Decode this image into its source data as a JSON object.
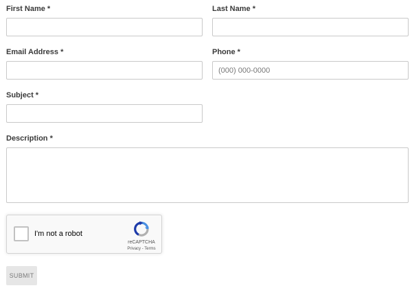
{
  "form": {
    "first_name": {
      "label": "First Name *",
      "value": "",
      "placeholder": ""
    },
    "last_name": {
      "label": "Last Name *",
      "value": "",
      "placeholder": ""
    },
    "email": {
      "label": "Email Address *",
      "value": "",
      "placeholder": ""
    },
    "phone": {
      "label": "Phone *",
      "value": "",
      "placeholder": "(000) 000-0000"
    },
    "subject": {
      "label": "Subject *",
      "value": "",
      "placeholder": ""
    },
    "description": {
      "label": "Description *",
      "value": "",
      "placeholder": ""
    },
    "submit_label": "SUBMIT"
  },
  "captcha": {
    "checkbox_label": "I'm not a robot",
    "checked": false,
    "brand": "reCAPTCHA",
    "privacy_link": "Privacy",
    "separator": " - ",
    "terms_link": "Terms",
    "logo_icon": "recaptcha-logo-icon",
    "colors": {
      "blue": "#4a90e2",
      "dark_blue": "#1c3aa9",
      "gray": "#b0b0b0"
    }
  },
  "colors": {
    "label_text": "#3a3a3a",
    "field_border": "#c8c8c8",
    "submit_background": "#e6e6e6",
    "submit_text": "#7a7a7a"
  }
}
